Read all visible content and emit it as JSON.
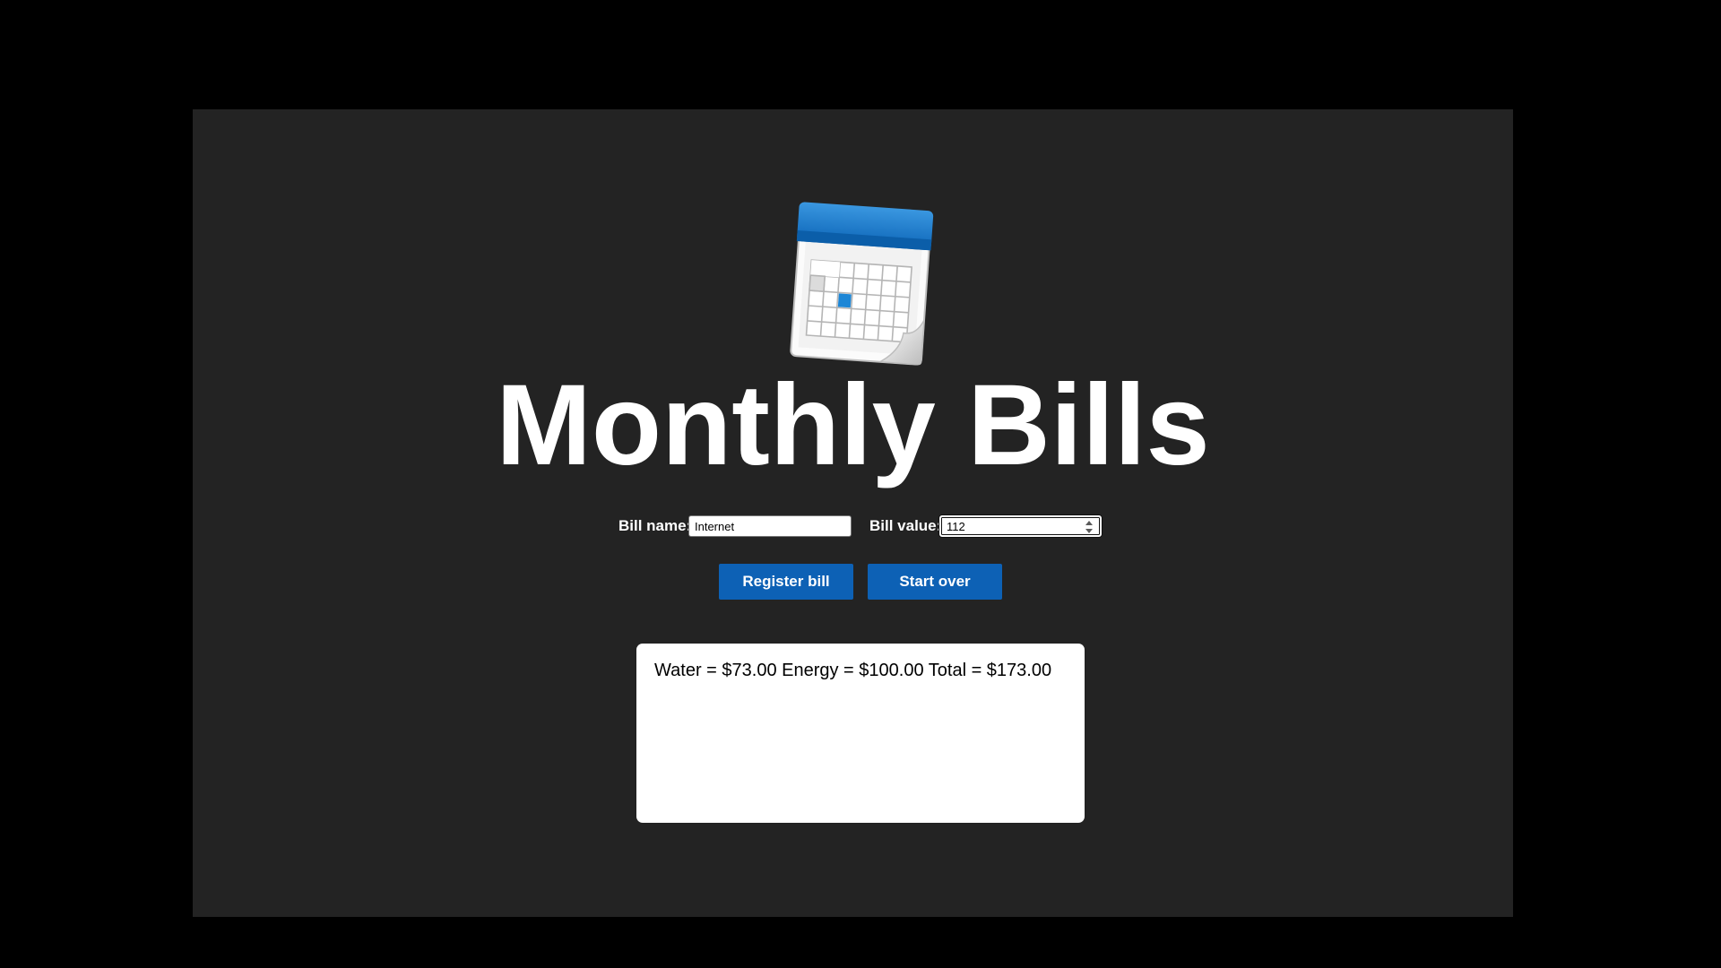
{
  "app": {
    "title": "Monthly Bills",
    "logo_icon": "calendar-icon"
  },
  "form": {
    "bill_name_label": "Bill name:",
    "bill_name_value": "Internet",
    "bill_value_label": "Bill value:",
    "bill_value_value": "112"
  },
  "buttons": {
    "register_label": "Register bill",
    "reset_label": "Start over"
  },
  "result": {
    "text": "Water = $73.00 Energy = $100.00 Total = $173.00"
  },
  "colors": {
    "page_background": "#000000",
    "panel_background": "#232323",
    "button_blue": "#0d61b5",
    "calendar_blue": "#1277c4",
    "text_white": "#ffffff"
  }
}
